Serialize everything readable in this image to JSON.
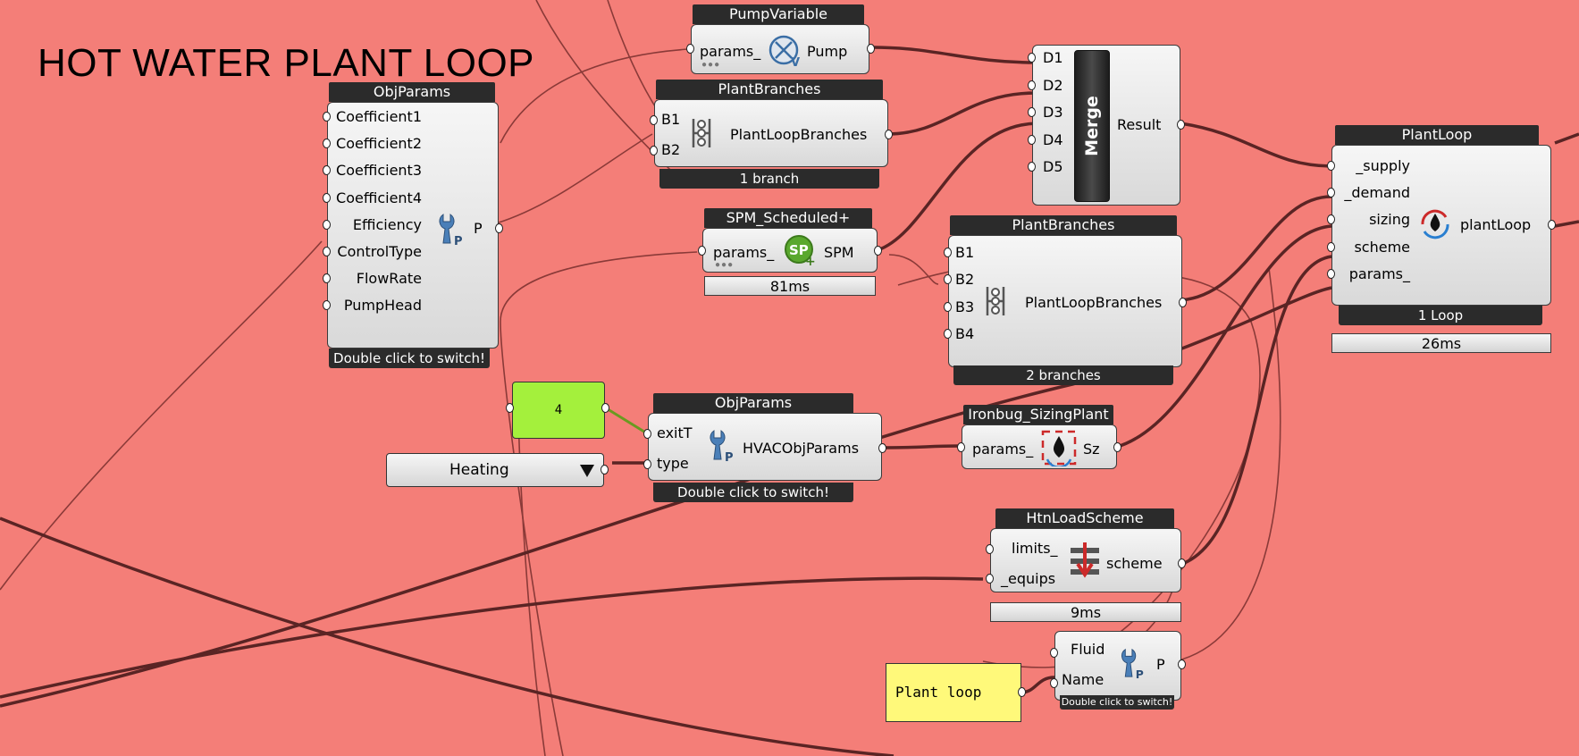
{
  "group_title": "HOT WATER PLANT LOOP",
  "colors": {
    "canvas": "#f47e78",
    "wire": "#5a2424",
    "slider": "#a4f03c",
    "panel": "#fff97a"
  },
  "pump_variable": {
    "title": "PumpVariable",
    "input": "params_",
    "output": "Pump",
    "icon": "pump-variable-icon"
  },
  "obj_params_pump": {
    "title": "ObjParams",
    "inputs": [
      "Coefficient1",
      "Coefficient2",
      "Coefficient3",
      "Coefficient4",
      "Efficiency",
      "ControlType",
      "FlowRate",
      "PumpHead"
    ],
    "output": "P",
    "footer": "Double click to switch!",
    "icon": "wrench-params-icon"
  },
  "plant_branches_supply": {
    "title": "PlantBranches",
    "inputs": [
      "B1",
      "B2"
    ],
    "label": "PlantLoopBranches",
    "footer": "1 branch",
    "icon": "branches-icon"
  },
  "merge": {
    "inputs": [
      "D1",
      "D2",
      "D3",
      "D4",
      "D5"
    ],
    "label": "Merge",
    "output": "Result"
  },
  "spm_scheduled": {
    "title": "SPM_Scheduled+",
    "input": "params_",
    "output": "SPM",
    "timing": "81ms",
    "icon": "setpoint-manager-icon"
  },
  "plant_branches_demand": {
    "title": "PlantBranches",
    "inputs": [
      "B1",
      "B2",
      "B3",
      "B4"
    ],
    "label": "PlantLoopBranches",
    "footer": "2 branches",
    "icon": "branches-icon"
  },
  "plant_loop": {
    "title": "PlantLoop",
    "inputs": [
      "_supply",
      "_demand",
      "sizing",
      "scheme",
      "params_"
    ],
    "output": "plantLoop",
    "footer": "1 Loop",
    "timing": "26ms",
    "icon": "plant-loop-icon"
  },
  "number_slider": {
    "value": "4"
  },
  "value_list": {
    "selected": "Heating",
    "icon": "dropdown-triangle-icon"
  },
  "obj_params_hvac": {
    "title": "ObjParams",
    "inputs": [
      "exitT",
      "type"
    ],
    "label": "HVACObjParams",
    "footer": "Double click to switch!",
    "icon": "wrench-params-icon"
  },
  "sizing_plant": {
    "title": "Ironbug_SizingPlant",
    "input": "params_",
    "output": "Sz",
    "icon": "sizing-plant-icon"
  },
  "htn_load_scheme": {
    "title": "HtnLoadScheme",
    "inputs": [
      "limits_",
      "_equips"
    ],
    "output": "scheme",
    "timing": "9ms",
    "icon": "load-scheme-icon"
  },
  "fluid_params": {
    "inputs": [
      "Fluid",
      "Name"
    ],
    "output": "P",
    "footer": "Double click to switch!",
    "icon": "wrench-params-icon"
  },
  "panel": {
    "text": "Plant loop"
  }
}
